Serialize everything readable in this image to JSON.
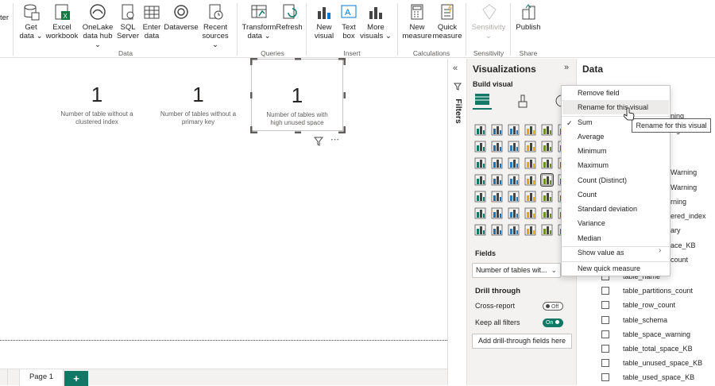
{
  "ribbon": {
    "cut_text": "ter",
    "buttons": [
      {
        "id": "get-data",
        "label": "Get\ndata ⌄"
      },
      {
        "id": "excel",
        "label": "Excel\nworkbook"
      },
      {
        "id": "onelake",
        "label": "OneLake\ndata hub ⌄"
      },
      {
        "id": "sql",
        "label": "SQL\nServer"
      },
      {
        "id": "enter",
        "label": "Enter\ndata"
      },
      {
        "id": "dataverse",
        "label": "Dataverse"
      },
      {
        "id": "recent",
        "label": "Recent\nsources ⌄"
      },
      {
        "id": "transform",
        "label": "Transform\ndata ⌄"
      },
      {
        "id": "refresh",
        "label": "Refresh"
      },
      {
        "id": "new-visual",
        "label": "New\nvisual"
      },
      {
        "id": "text-box",
        "label": "Text\nbox"
      },
      {
        "id": "more-visuals",
        "label": "More\nvisuals ⌄"
      },
      {
        "id": "new-measure",
        "label": "New\nmeasure"
      },
      {
        "id": "quick-measure",
        "label": "Quick\nmeasure"
      },
      {
        "id": "sensitivity",
        "label": "Sensitivity\n⌄"
      },
      {
        "id": "publish",
        "label": "Publish"
      }
    ],
    "groups": [
      "Data",
      "Queries",
      "Insert",
      "Calculations",
      "Sensitivity",
      "Share"
    ]
  },
  "cards": [
    {
      "value": "1",
      "label": "Number of table without a clustered index"
    },
    {
      "value": "1",
      "label": "Number of tables without a primary key"
    },
    {
      "value": "1",
      "label": "Number of tables with high unused space"
    }
  ],
  "tabs": {
    "page1": "Page 1",
    "add": "+"
  },
  "filters": {
    "label": "Filters"
  },
  "viz": {
    "title": "Visualizations",
    "build": "Build visual",
    "fields_label": "Fields",
    "field_value": "Number of tables wit...",
    "drill_title": "Drill through",
    "cross_report": "Cross-report",
    "cross_report_state": "Off",
    "keep_filters": "Keep all filters",
    "keep_filters_state": "On",
    "add_drill": "Add drill-through fields here"
  },
  "data_pane": {
    "title": "Data",
    "partial_items": [
      "ning",
      "ing",
      "Warning",
      "Warning",
      "rning",
      "ered_index",
      "ary",
      "ace_KB",
      "count"
    ],
    "items": [
      "table_name",
      "table_partitions_count",
      "table_row_count",
      "table_schema",
      "table_space_warning",
      "table_total_space_KB",
      "table_unused_space_KB",
      "table_used_space_KB"
    ]
  },
  "menu": {
    "items": [
      "Remove field",
      "Rename for this visual",
      "Sum",
      "Average",
      "Minimum",
      "Maximum",
      "Count (Distinct)",
      "Count",
      "Standard deviation",
      "Variance",
      "Median",
      "Show value as",
      "New quick measure"
    ],
    "checked": "Sum"
  },
  "tooltip": "Rename for this visual",
  "colors": {
    "accent": "#117865",
    "selected_icon": "#1a7a6a",
    "toggle_on": "#117865"
  }
}
